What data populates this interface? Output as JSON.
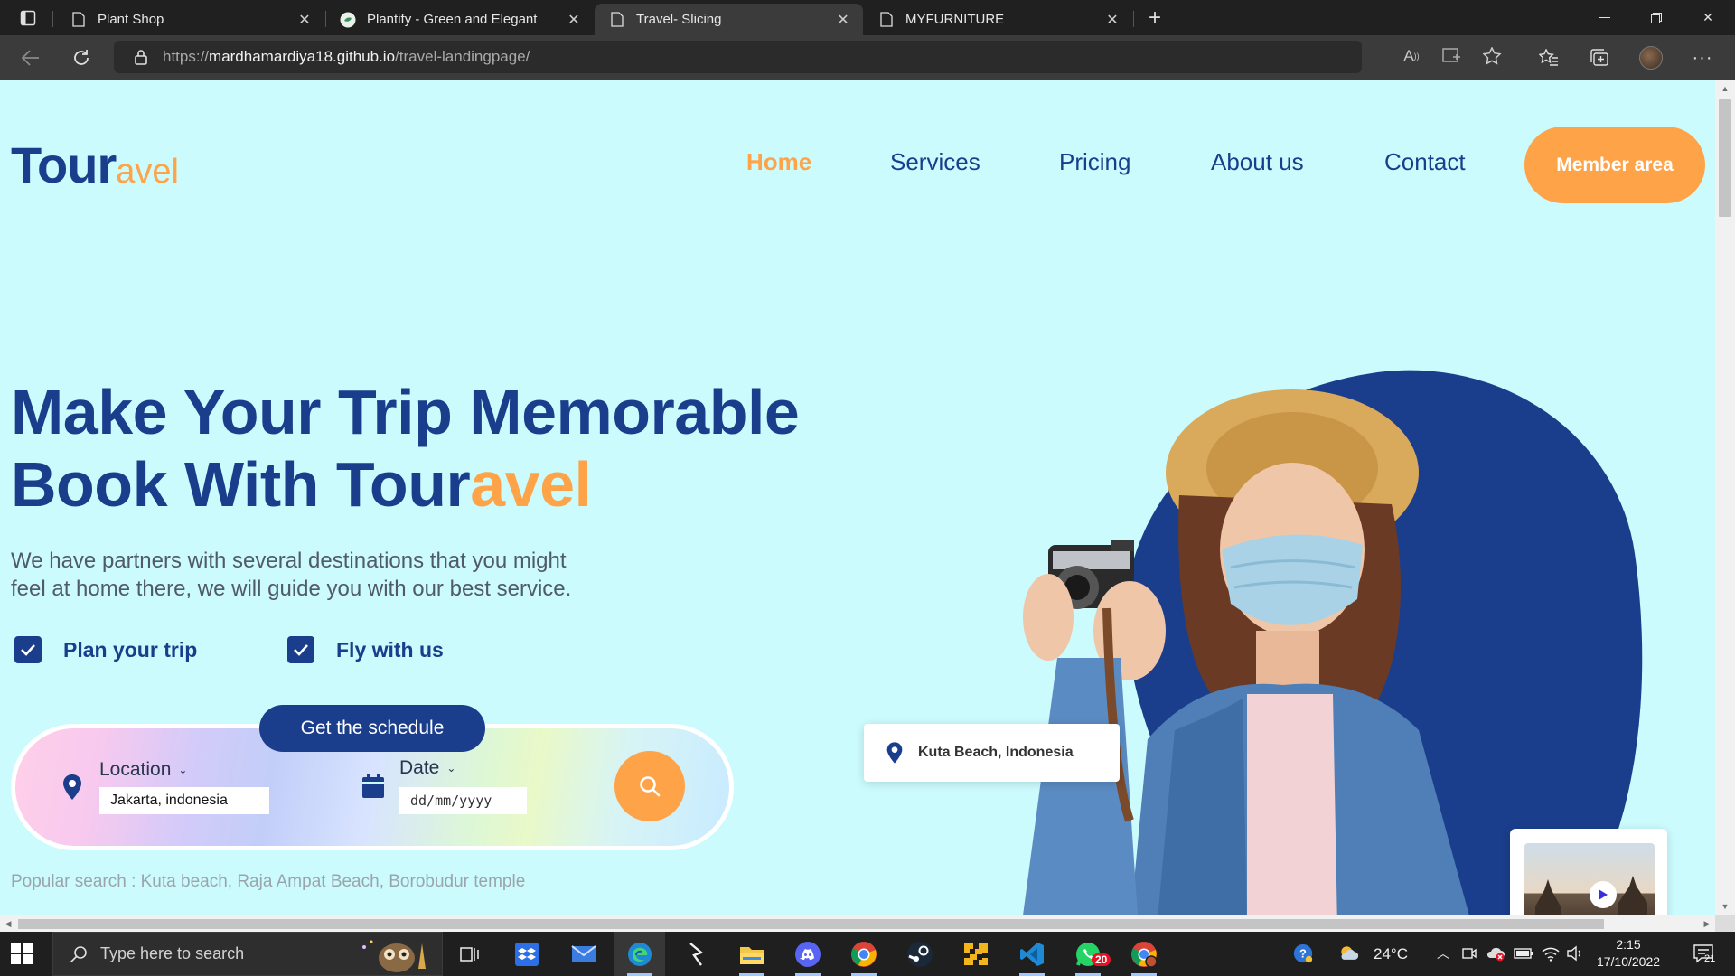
{
  "browser": {
    "tabs": [
      {
        "title": "Plant Shop",
        "active": false
      },
      {
        "title": "Plantify - Green and Elegant",
        "active": false
      },
      {
        "title": "Travel- Slicing",
        "active": true
      },
      {
        "title": "MYFURNITURE",
        "active": false
      }
    ],
    "url_prefix": "https://",
    "url_host": "mardhamardiya18.github.io",
    "url_path": "/travel-landingpage/"
  },
  "site": {
    "logo_main": "Tour",
    "logo_accent": "avel",
    "nav": [
      {
        "label": "Home",
        "active": true
      },
      {
        "label": "Services",
        "active": false
      },
      {
        "label": "Pricing",
        "active": false
      },
      {
        "label": "About us",
        "active": false
      },
      {
        "label": "Contact",
        "active": false
      }
    ],
    "member_button": "Member area",
    "colors": {
      "primary": "#1b3e8c",
      "accent": "#ffa349",
      "background": "#ccfbfd"
    }
  },
  "hero": {
    "title_line1": "Make Your Trip Memorable",
    "title_line2_main": "Book With Tour",
    "title_line2_accent": "avel",
    "description": "We have partners with several destinations that you might feel at home there, we will guide you with our best service.",
    "features": [
      "Plan your trip",
      "Fly with us"
    ],
    "schedule_button": "Get the schedule",
    "location_label": "Location",
    "location_value": "Jakarta, indonesia",
    "date_label": "Date",
    "date_placeholder": "dd/mm/yyyy",
    "popular": "Popular search : Kuta beach, Raja Ampat Beach, Borobudur temple",
    "location_card": "Kuta Beach, Indonesia"
  },
  "taskbar": {
    "search_placeholder": "Type here to search",
    "weather": "24°C",
    "time": "2:15",
    "date": "17/10/2022",
    "whatsapp_badge": "20",
    "notification_count": "21"
  }
}
